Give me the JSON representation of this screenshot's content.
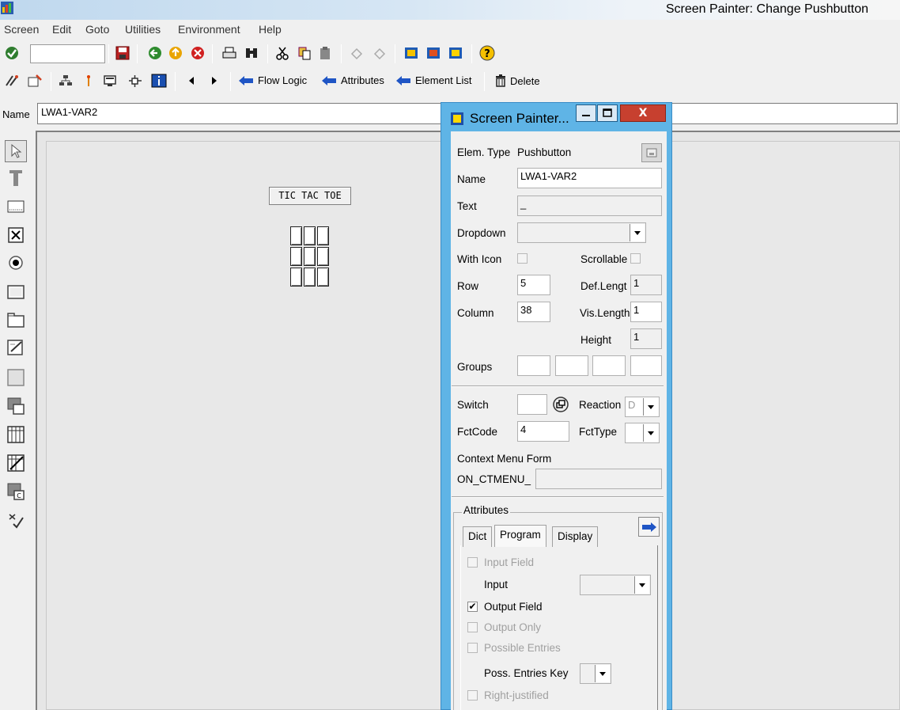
{
  "window": {
    "title": "Screen Painter:  Change Pushbutton"
  },
  "menu": [
    "Screen",
    "Edit",
    "Goto",
    "Utilities",
    "Environment",
    "Help"
  ],
  "toolbar2": {
    "flow_logic": "Flow Logic",
    "attributes": "Attributes",
    "element_list": "Element List",
    "delete": "Delete"
  },
  "name_row": {
    "label": "Name",
    "value": "LWA1-VAR2"
  },
  "canvas": {
    "ttt_label": "TIC TAC TOE"
  },
  "dialog": {
    "title": "Screen Painter...",
    "close": "X",
    "elem_type_label": "Elem. Type",
    "elem_type_value": "Pushbutton",
    "name_label": "Name",
    "name_value": "LWA1-VAR2",
    "text_label": "Text",
    "text_value": "_",
    "dropdown_label": "Dropdown",
    "with_icon_label": "With Icon",
    "scrollable_label": "Scrollable",
    "row_label": "Row",
    "row_value": "5",
    "def_length_label": "Def.Lengt",
    "def_length_value": "1",
    "column_label": "Column",
    "column_value": "38",
    "vis_length_label": "Vis.Length",
    "vis_length_value": "1",
    "height_label": "Height",
    "height_value": "1",
    "groups_label": "Groups",
    "switch_label": "Switch",
    "reaction_label": "Reaction",
    "reaction_value": "D",
    "fctcode_label": "FctCode",
    "fctcode_value": "4",
    "fcttype_label": "FctType",
    "context_menu_label": "Context Menu Form",
    "on_ctmenu_label": "ON_CTMENU_",
    "attributes_group": "Attributes",
    "tabs": [
      "Dict",
      "Program",
      "Display"
    ],
    "program": {
      "input_field": "Input Field",
      "input": "Input",
      "output_field": "Output Field",
      "output_only": "Output Only",
      "possible_entries": "Possible Entries",
      "poss_entries_key": "Poss. Entries Key",
      "right_justified": "Right-justified"
    }
  }
}
